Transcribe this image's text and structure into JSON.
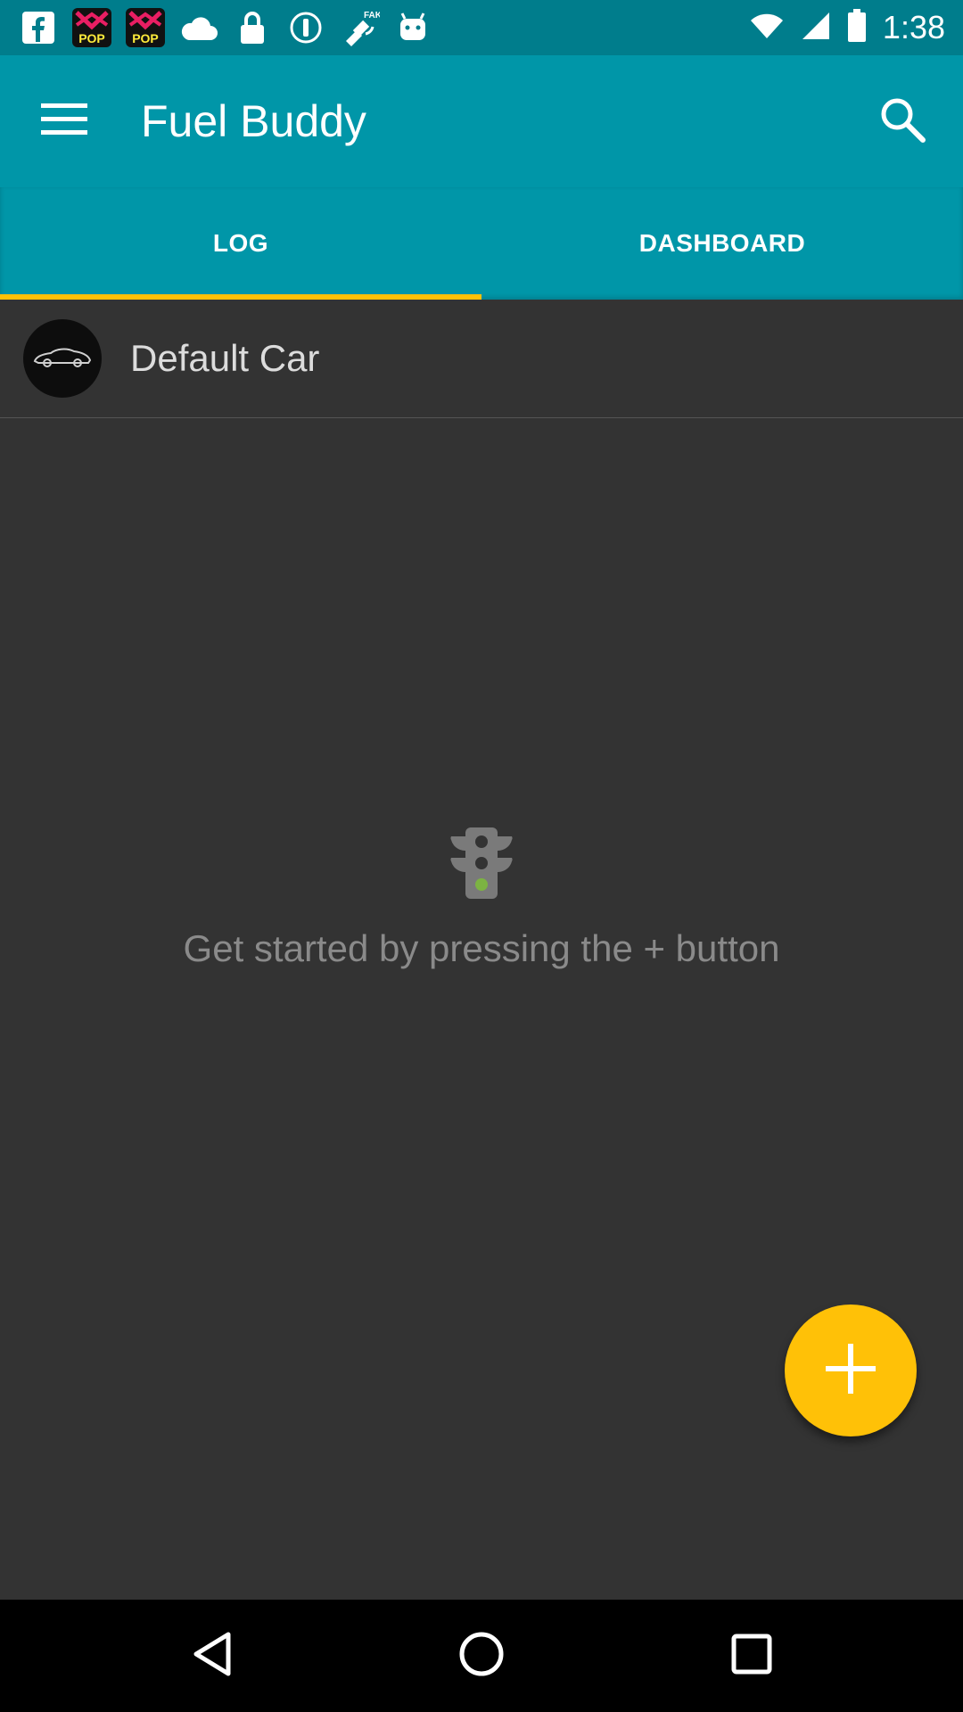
{
  "status_bar": {
    "time": "1:38",
    "notification_icons": [
      "facebook-icon",
      "pop-app-icon",
      "pop-app-icon",
      "cloud-icon",
      "lock-icon",
      "info-icon",
      "fake-gps-icon",
      "android-icon"
    ],
    "status_icons": [
      "wifi-icon",
      "signal-icon",
      "battery-icon"
    ]
  },
  "app_bar": {
    "title": "Fuel Buddy",
    "menu_icon": "hamburger-menu-icon",
    "search_icon": "search-icon"
  },
  "tabs": [
    {
      "label": "LOG",
      "selected": true
    },
    {
      "label": "DASHBOARD",
      "selected": false
    }
  ],
  "car": {
    "name": "Default Car",
    "avatar_icon": "car-icon"
  },
  "empty_state": {
    "icon": "traffic-light-icon",
    "message": "Get started by pressing the + button"
  },
  "fab": {
    "icon": "plus-icon"
  },
  "nav": {
    "back_icon": "back-icon",
    "home_icon": "home-icon",
    "recents_icon": "recents-icon"
  },
  "colors": {
    "primary": "#0096a8",
    "primary_dark": "#007d8c",
    "accent": "#ffc107",
    "background": "#333333"
  }
}
